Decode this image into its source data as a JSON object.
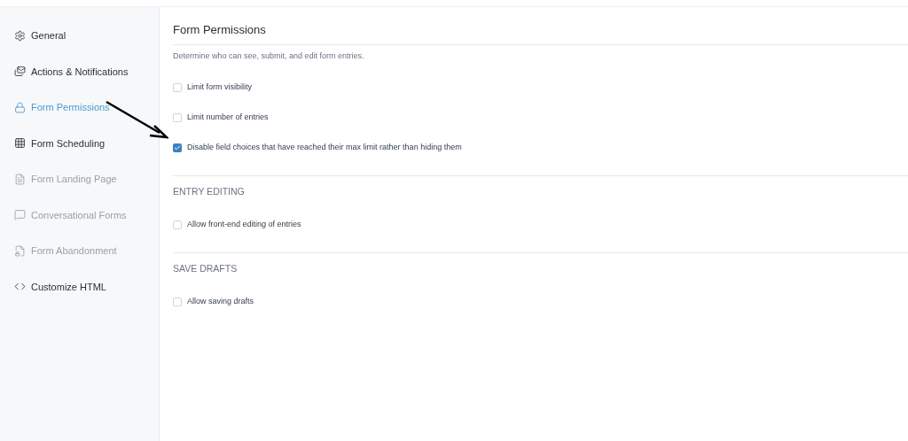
{
  "sidebar": {
    "items": [
      {
        "label": "General",
        "kind": "gear",
        "selected": false,
        "disabled": false
      },
      {
        "label": "Actions & Notifications",
        "kind": "mail",
        "selected": false,
        "disabled": false
      },
      {
        "label": "Form Permissions",
        "kind": "lock",
        "selected": true,
        "disabled": false
      },
      {
        "label": "Form Scheduling",
        "kind": "calendar",
        "selected": false,
        "disabled": false
      },
      {
        "label": "Form Landing Page",
        "kind": "file",
        "selected": false,
        "disabled": true
      },
      {
        "label": "Conversational Forms",
        "kind": "chat",
        "selected": false,
        "disabled": true
      },
      {
        "label": "Form Abandonment",
        "kind": "filelock",
        "selected": false,
        "disabled": true
      },
      {
        "label": "Customize HTML",
        "kind": "code",
        "selected": false,
        "disabled": false
      }
    ]
  },
  "content": {
    "title": "Form Permissions",
    "description": "Determine who can see, submit, and edit form entries.",
    "sections": [
      {
        "options": [
          {
            "label": "Limit form visibility",
            "checked": false
          },
          {
            "label": "Limit number of entries",
            "checked": false
          },
          {
            "label": "Disable field choices that have reached their max limit rather than hiding them",
            "checked": true
          }
        ]
      },
      {
        "heading": "ENTRY EDITING",
        "options": [
          {
            "label": "Allow front-end editing of entries",
            "checked": false
          }
        ]
      },
      {
        "heading": "SAVE DRAFTS",
        "options": [
          {
            "label": "Allow saving drafts",
            "checked": false
          }
        ]
      }
    ]
  }
}
